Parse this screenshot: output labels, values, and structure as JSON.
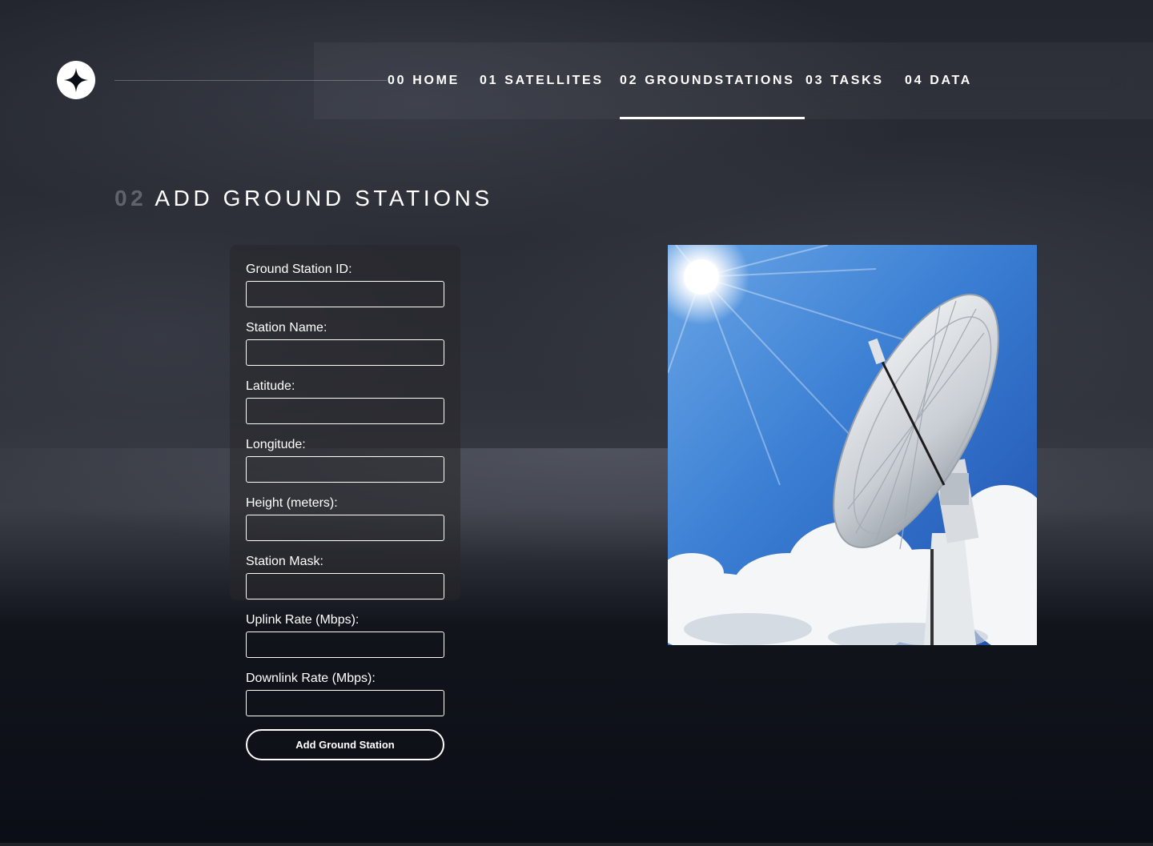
{
  "nav": {
    "items": [
      {
        "num": "00",
        "label": "HOME",
        "active": false
      },
      {
        "num": "01",
        "label": "SATELLITES",
        "active": false
      },
      {
        "num": "02",
        "label": "GROUNDSTATIONS",
        "active": true
      },
      {
        "num": "03",
        "label": "TASKS",
        "active": false
      },
      {
        "num": "04",
        "label": "DATA",
        "active": false
      }
    ]
  },
  "page": {
    "heading_num": "02",
    "heading_text": "ADD GROUND STATIONS"
  },
  "form": {
    "fields": [
      {
        "label": "Ground Station ID:",
        "value": ""
      },
      {
        "label": "Station Name:",
        "value": ""
      },
      {
        "label": "Latitude:",
        "value": ""
      },
      {
        "label": "Longitude:",
        "value": ""
      },
      {
        "label": "Height (meters):",
        "value": ""
      },
      {
        "label": "Station Mask:",
        "value": ""
      },
      {
        "label": "Uplink Rate (Mbps):",
        "value": ""
      },
      {
        "label": "Downlink Rate (Mbps):",
        "value": ""
      }
    ],
    "submit_label": "Add Ground Station"
  },
  "colors": {
    "text": "#ffffff",
    "background": "#0b0e16",
    "sky": "#2f6fc6"
  }
}
